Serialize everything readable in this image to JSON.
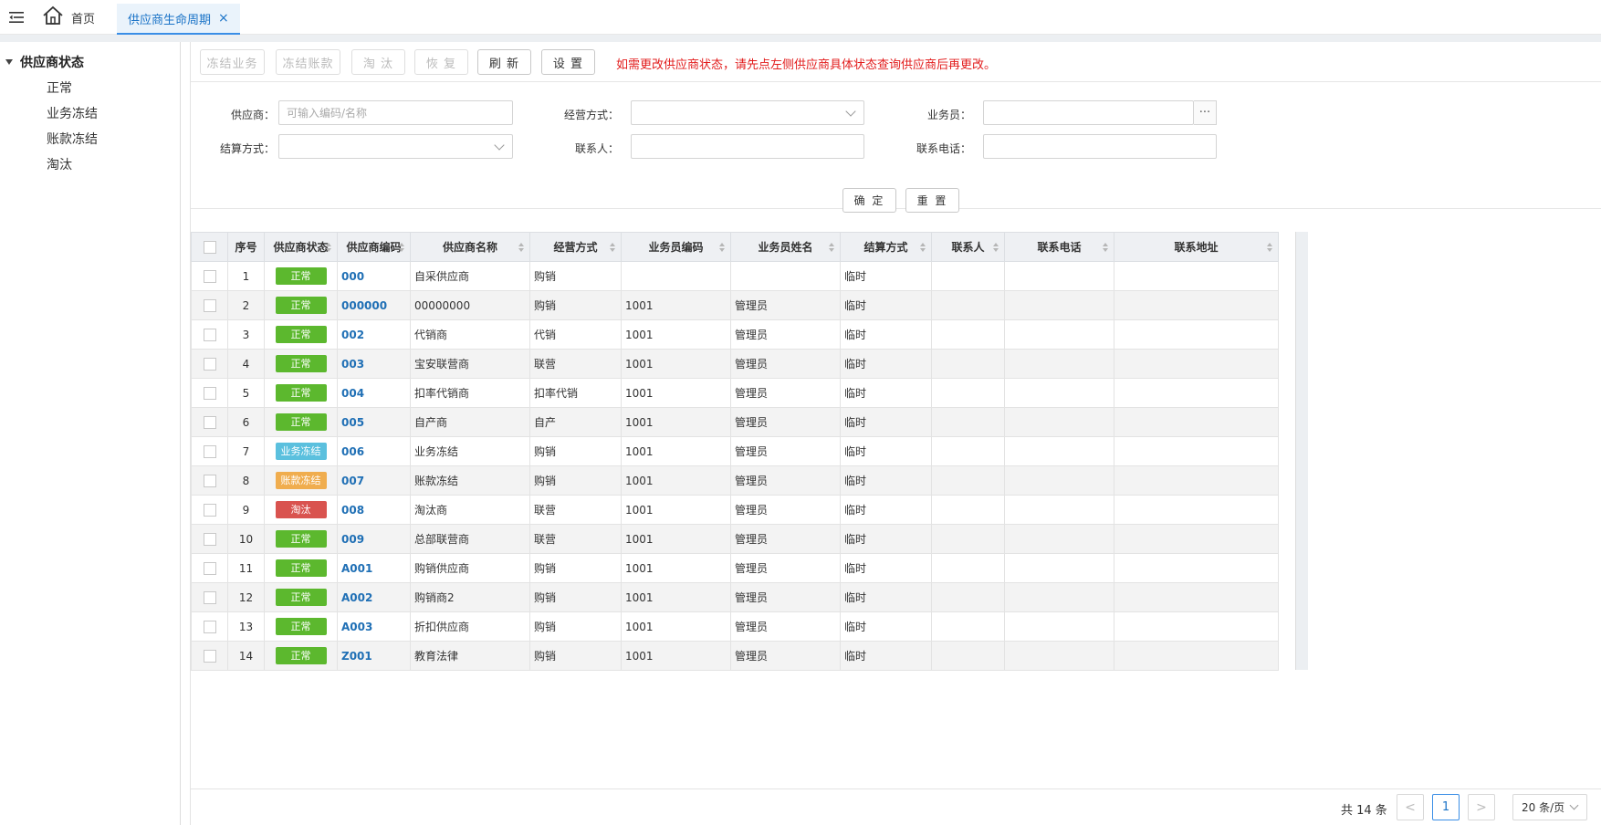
{
  "tabs": {
    "home_label": "首页",
    "active_label": "供应商生命周期",
    "close_glyph": "×"
  },
  "sidebar": {
    "root_label": "供应商状态",
    "items": [
      {
        "label": "正常"
      },
      {
        "label": "业务冻结"
      },
      {
        "label": "账款冻结"
      },
      {
        "label": "淘汰"
      }
    ]
  },
  "toolbar": {
    "freeze_business": "冻结业务",
    "freeze_account": "冻结账款",
    "eliminate": "淘 汰",
    "restore": "恢 复",
    "refresh": "刷 新",
    "settings": "设 置",
    "notice": "如需更改供应商状态，请先点左侧供应商具体状态查询供应商后再更改。"
  },
  "filters": {
    "supplier_label": "供应商：",
    "supplier_placeholder": "可输入编码/名称",
    "business_mode_label": "经营方式：",
    "salesman_label": "业务员：",
    "salesman_button": "···",
    "settlement_label": "结算方式：",
    "contact_label": "联系人：",
    "phone_label": "联系电话：",
    "confirm": "确 定",
    "reset": "重 置"
  },
  "table": {
    "columns": [
      "序号",
      "供应商状态",
      "供应商编码",
      "供应商名称",
      "经营方式",
      "业务员编码",
      "业务员姓名",
      "结算方式",
      "联系人",
      "联系电话",
      "联系地址"
    ],
    "rows": [
      {
        "seq": "1",
        "status": "正常",
        "code": "000",
        "name": "自采供应商",
        "mode": "购销",
        "sales_code": "",
        "sales_name": "",
        "settle": "临时",
        "contact": "",
        "phone": "",
        "address": ""
      },
      {
        "seq": "2",
        "status": "正常",
        "code": "000000",
        "name": "00000000",
        "mode": "购销",
        "sales_code": "1001",
        "sales_name": "管理员",
        "settle": "临时",
        "contact": "",
        "phone": "",
        "address": ""
      },
      {
        "seq": "3",
        "status": "正常",
        "code": "002",
        "name": "代销商",
        "mode": "代销",
        "sales_code": "1001",
        "sales_name": "管理员",
        "settle": "临时",
        "contact": "",
        "phone": "",
        "address": ""
      },
      {
        "seq": "4",
        "status": "正常",
        "code": "003",
        "name": "宝安联营商",
        "mode": "联营",
        "sales_code": "1001",
        "sales_name": "管理员",
        "settle": "临时",
        "contact": "",
        "phone": "",
        "address": ""
      },
      {
        "seq": "5",
        "status": "正常",
        "code": "004",
        "name": "扣率代销商",
        "mode": "扣率代销",
        "sales_code": "1001",
        "sales_name": "管理员",
        "settle": "临时",
        "contact": "",
        "phone": "",
        "address": ""
      },
      {
        "seq": "6",
        "status": "正常",
        "code": "005",
        "name": "自产商",
        "mode": "自产",
        "sales_code": "1001",
        "sales_name": "管理员",
        "settle": "临时",
        "contact": "",
        "phone": "",
        "address": ""
      },
      {
        "seq": "7",
        "status": "业务冻结",
        "code": "006",
        "name": "业务冻结",
        "mode": "购销",
        "sales_code": "1001",
        "sales_name": "管理员",
        "settle": "临时",
        "contact": "",
        "phone": "",
        "address": ""
      },
      {
        "seq": "8",
        "status": "账款冻结",
        "code": "007",
        "name": "账款冻结",
        "mode": "购销",
        "sales_code": "1001",
        "sales_name": "管理员",
        "settle": "临时",
        "contact": "",
        "phone": "",
        "address": ""
      },
      {
        "seq": "9",
        "status": "淘汰",
        "code": "008",
        "name": "淘汰商",
        "mode": "联营",
        "sales_code": "1001",
        "sales_name": "管理员",
        "settle": "临时",
        "contact": "",
        "phone": "",
        "address": ""
      },
      {
        "seq": "10",
        "status": "正常",
        "code": "009",
        "name": "总部联营商",
        "mode": "联营",
        "sales_code": "1001",
        "sales_name": "管理员",
        "settle": "临时",
        "contact": "",
        "phone": "",
        "address": ""
      },
      {
        "seq": "11",
        "status": "正常",
        "code": "A001",
        "name": "购销供应商",
        "mode": "购销",
        "sales_code": "1001",
        "sales_name": "管理员",
        "settle": "临时",
        "contact": "",
        "phone": "",
        "address": ""
      },
      {
        "seq": "12",
        "status": "正常",
        "code": "A002",
        "name": "购销商2",
        "mode": "购销",
        "sales_code": "1001",
        "sales_name": "管理员",
        "settle": "临时",
        "contact": "",
        "phone": "",
        "address": ""
      },
      {
        "seq": "13",
        "status": "正常",
        "code": "A003",
        "name": "折扣供应商",
        "mode": "购销",
        "sales_code": "1001",
        "sales_name": "管理员",
        "settle": "临时",
        "contact": "",
        "phone": "",
        "address": ""
      },
      {
        "seq": "14",
        "status": "正常",
        "code": "Z001",
        "name": "教育法律",
        "mode": "购销",
        "sales_code": "1001",
        "sales_name": "管理员",
        "settle": "临时",
        "contact": "",
        "phone": "",
        "address": ""
      }
    ]
  },
  "status_colors": {
    "正常": "#5cb82e",
    "业务冻结": "#5bc0de",
    "账款冻结": "#f0ad4e",
    "淘汰": "#d9534f"
  },
  "pagination": {
    "total": "共 14 条",
    "prev_glyph": "<",
    "current_page": "1",
    "next_glyph": ">",
    "page_size": "20 条/页"
  }
}
